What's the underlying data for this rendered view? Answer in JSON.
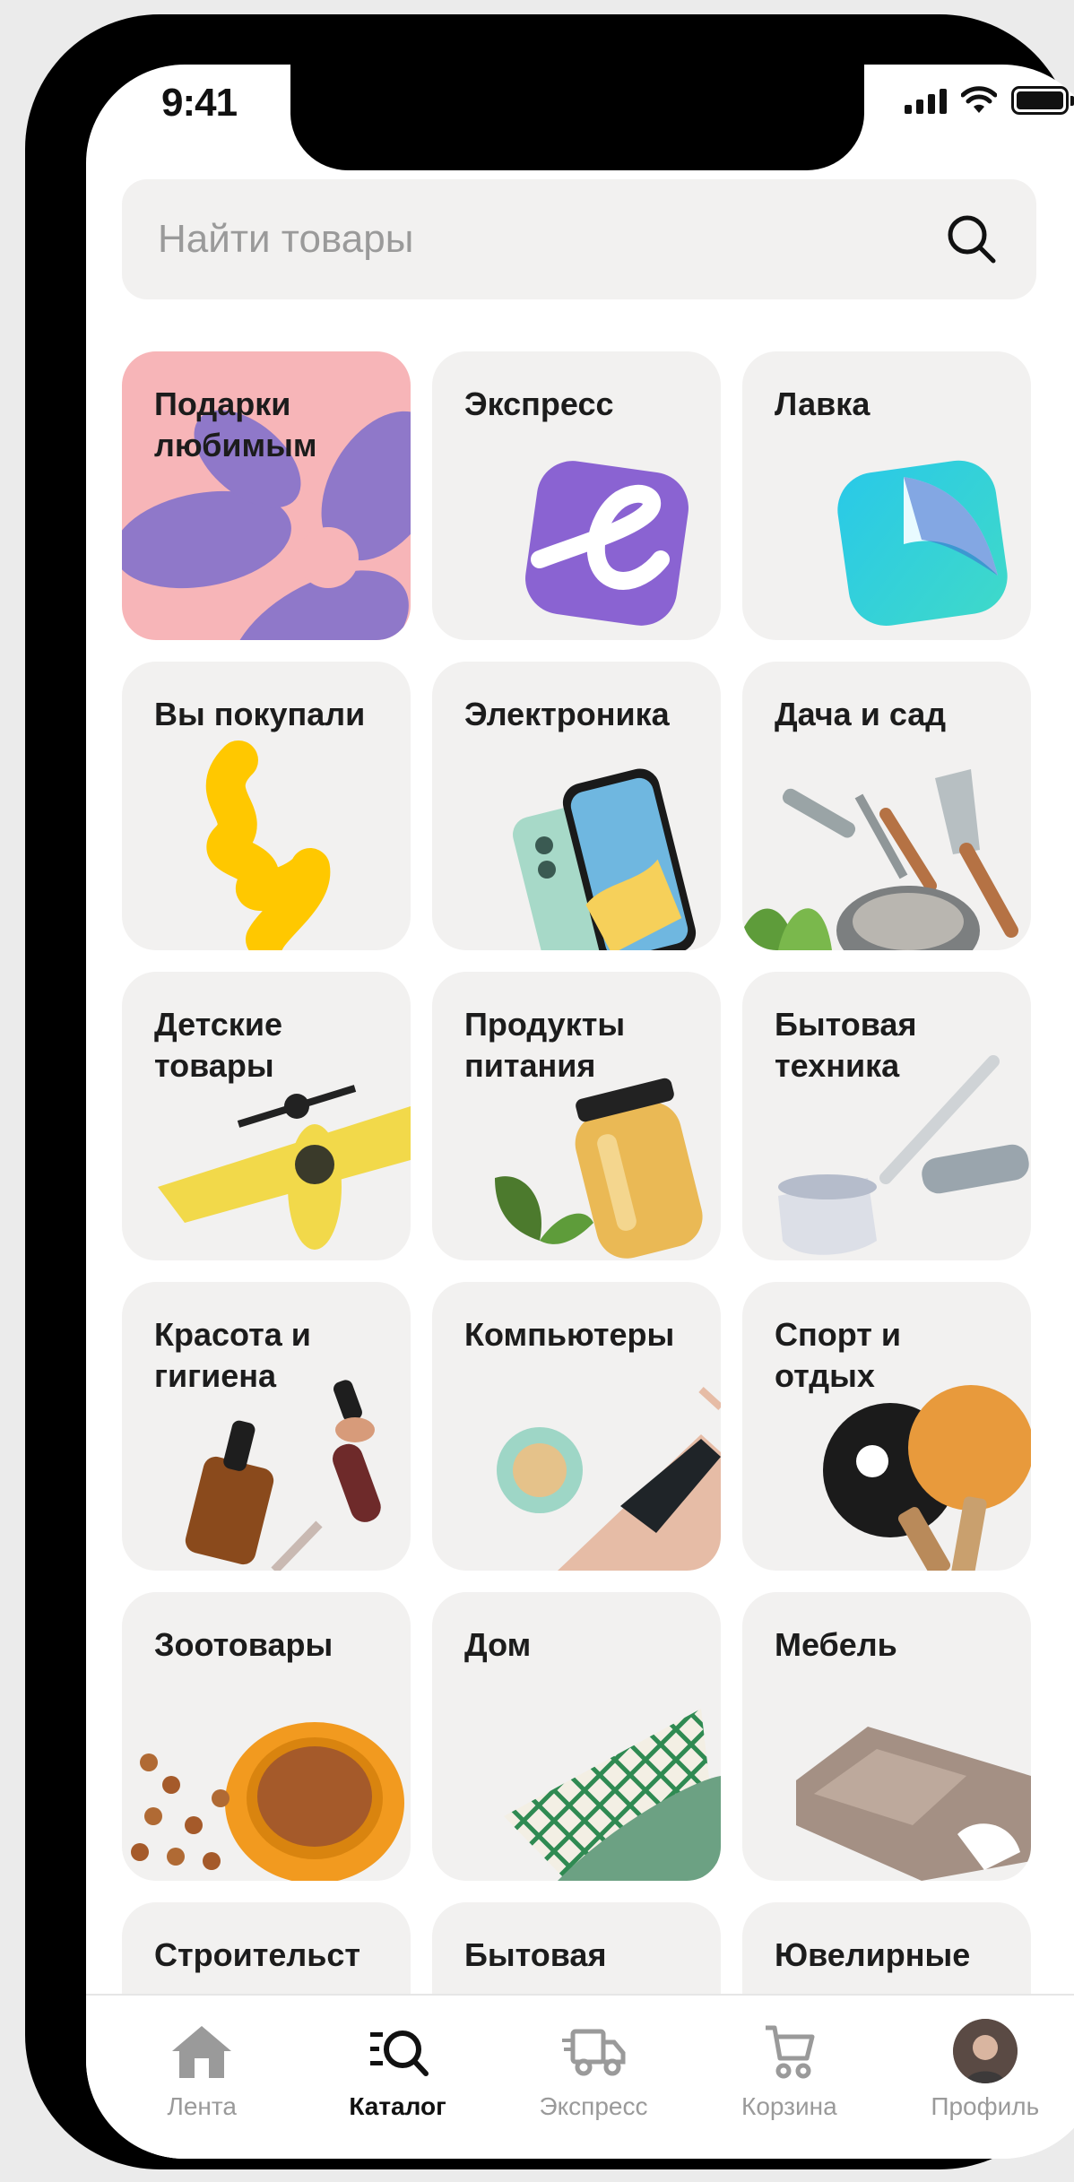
{
  "status_bar": {
    "time": "9:41"
  },
  "search": {
    "placeholder": "Найти товары"
  },
  "categories": [
    {
      "label": "Подарки\nлюбимым",
      "icon": "gift-flower-art"
    },
    {
      "label": "Экспресс",
      "icon": "express-app-icon"
    },
    {
      "label": "Лавка",
      "icon": "lavka-app-icon"
    },
    {
      "label": "Вы покупали",
      "icon": "purchased-scribble-art"
    },
    {
      "label": "Электроника",
      "icon": "smartphone-art"
    },
    {
      "label": "Дача и сад",
      "icon": "garden-tools-art"
    },
    {
      "label": "Детские\nтовары",
      "icon": "toy-plane-art"
    },
    {
      "label": "Продукты\nпитания",
      "icon": "honey-jar-art"
    },
    {
      "label": "Бытовая\nтехника",
      "icon": "blender-art"
    },
    {
      "label": "Красота и\nгигиена",
      "icon": "cosmetics-art"
    },
    {
      "label": "Компьютеры",
      "icon": "laptop-art"
    },
    {
      "label": "Спорт и\nотдых",
      "icon": "ping-pong-art"
    },
    {
      "label": "Зоотовары",
      "icon": "pet-food-art"
    },
    {
      "label": "Дом",
      "icon": "pillow-art"
    },
    {
      "label": "Мебель",
      "icon": "sofa-art"
    },
    {
      "label": "Строительст",
      "icon": ""
    },
    {
      "label": "Бытовая",
      "icon": ""
    },
    {
      "label": "Ювелирные",
      "icon": ""
    }
  ],
  "tab_bar": {
    "items": [
      {
        "label": "Лента",
        "icon": "home-icon"
      },
      {
        "label": "Каталог",
        "icon": "catalog-search-icon",
        "active": true
      },
      {
        "label": "Экспресс",
        "icon": "truck-icon"
      },
      {
        "label": "Корзина",
        "icon": "cart-icon"
      },
      {
        "label": "Профиль",
        "icon": "avatar"
      }
    ]
  },
  "colors": {
    "accent": "#8a63d2",
    "tile_bg": "#f2f1f0",
    "gift_bg": "#f7b5b8",
    "yellow": "#ffc800"
  }
}
